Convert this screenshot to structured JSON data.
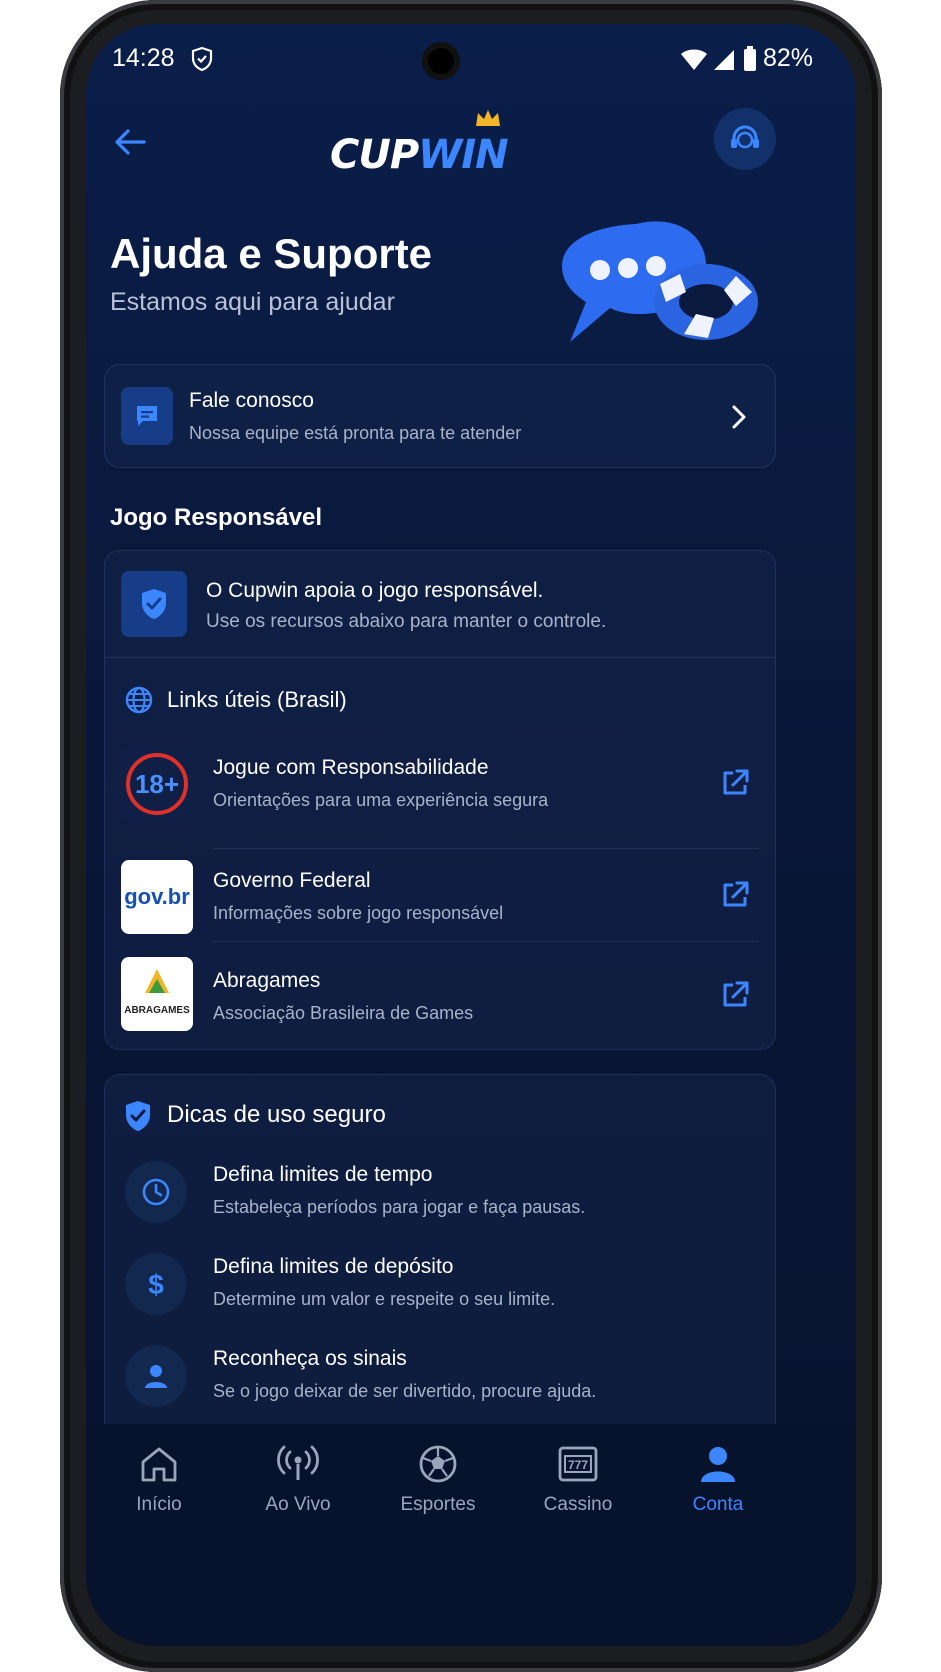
{
  "status_bar": {
    "time": "14:28",
    "battery_pct": "82%"
  },
  "header": {
    "logo_part1": "CUP",
    "logo_part2": "WIN"
  },
  "page": {
    "title": "Ajuda e Suporte",
    "subtitle": "Estamos aqui para ajudar"
  },
  "contact": {
    "title": "Fale conosco",
    "subtitle": "Nossa equipe está pronta para te atender"
  },
  "responsible": {
    "section_title": "Jogo Responsável",
    "intro_title": "O Cupwin apoia o jogo responsável.",
    "intro_sub": "Use os recursos abaixo para manter o controle.",
    "links_title": "Links úteis (Brasil)",
    "links": [
      {
        "title": "Jogue com Responsabilidade",
        "subtitle": "Orientações para uma experiência segura",
        "badge": "18+"
      },
      {
        "title": "Governo Federal",
        "subtitle": "Informações sobre jogo responsável",
        "badge": "gov.br"
      },
      {
        "title": "Abragames",
        "subtitle": "Associação Brasileira de Games",
        "badge": "ABRAGAMES"
      }
    ]
  },
  "tips": {
    "title": "Dicas de uso seguro",
    "items": [
      {
        "title": "Defina limites de tempo",
        "subtitle": "Estabeleça períodos para jogar e faça pausas."
      },
      {
        "title": "Defina limites de depósito",
        "subtitle": "Determine um valor e respeite o seu limite."
      },
      {
        "title": "Reconheça os sinais",
        "subtitle": "Se o jogo deixar de ser divertido, procure ajuda."
      }
    ]
  },
  "nav": [
    {
      "label": "Início",
      "icon": "home-icon"
    },
    {
      "label": "Ao Vivo",
      "icon": "broadcast-icon"
    },
    {
      "label": "Esportes",
      "icon": "soccer-ball-icon"
    },
    {
      "label": "Cassino",
      "icon": "slot-machine-icon"
    },
    {
      "label": "Conta",
      "icon": "user-icon",
      "active": true
    }
  ],
  "colors": {
    "accent": "#3c86ff",
    "background": "#0a1a3e",
    "card": "#14244a",
    "alert_red": "#e0302a"
  }
}
